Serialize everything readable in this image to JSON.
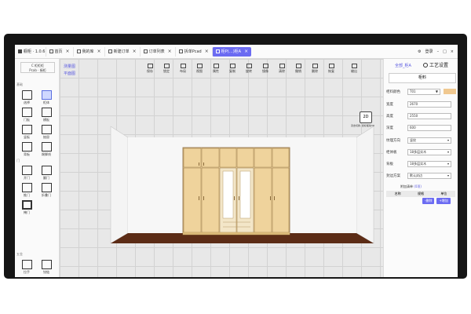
{
  "window": {
    "title": "橱柜 · 1.0.6",
    "tabs": [
      {
        "label": "首页",
        "active": false
      },
      {
        "label": "我的库",
        "active": false
      },
      {
        "label": "新建订单",
        "active": false
      },
      {
        "label": "订单列表",
        "active": false
      },
      {
        "label": "拆单Pcad",
        "active": false
      },
      {
        "label": "柜P(…)柜A",
        "active": true
      }
    ],
    "right_items": [
      "登录"
    ]
  },
  "sidebar": {
    "logo_line1": "C 柜柜柜",
    "logo_line2": "Pcab · 橱柜",
    "section_basic": "基础",
    "tools": [
      {
        "label": "选择",
        "selected": false
      },
      {
        "label": "柜体",
        "selected": true
      },
      {
        "label": "门板",
        "selected": false
      },
      {
        "label": "横板",
        "selected": false
      },
      {
        "label": "竖板",
        "selected": false
      },
      {
        "label": "抽屉",
        "selected": false
      },
      {
        "label": "背板",
        "selected": false
      },
      {
        "label": "踢脚线",
        "selected": false
      }
    ],
    "section_door": "门",
    "door_tools": [
      {
        "label": "开门",
        "selected": false
      },
      {
        "label": "翻门",
        "selected": false
      },
      {
        "label": "推门",
        "selected": false
      },
      {
        "label": "折叠门",
        "selected": false
      },
      {
        "label": "掩门",
        "selected": false
      }
    ],
    "section_hw": "五金",
    "hw_tools": [
      {
        "label": "拉手"
      },
      {
        "label": "铰链"
      }
    ]
  },
  "canvas": {
    "links": [
      "测量图",
      "平面图"
    ],
    "toolbar": [
      "保存",
      "锁定",
      "布局",
      "视图",
      "属性",
      "复制",
      "旋转",
      "镜像",
      "清除",
      "撤销",
      "删除",
      "恢复",
      "输出"
    ],
    "view_toggle": "2D",
    "view_note": "双击切换, 鼠标拖动3D"
  },
  "panel": {
    "header_link": "全部_柜A",
    "title": "工艺设置",
    "button": "柜料",
    "fields": [
      {
        "label": "柜料颜色",
        "value": "T01",
        "type": "select",
        "swatch": "#f0c890"
      },
      {
        "label": "宽度",
        "value": "2670",
        "type": "input"
      },
      {
        "label": "高度",
        "value": "2550",
        "type": "input"
      },
      {
        "label": "深度",
        "value": "600",
        "type": "input"
      },
      {
        "label": "纹理方向",
        "value": "竖纹",
        "type": "select"
      },
      {
        "label": "柜体板",
        "value": "18多层实木",
        "type": "select"
      },
      {
        "label": "背板",
        "value": "18多层实木",
        "type": "select"
      },
      {
        "label": "封边方案",
        "value": "默认封边",
        "type": "select"
      }
    ],
    "library_label": "附加清单",
    "library_link": "(0项)",
    "table_headers": [
      "名称",
      "规格",
      "单位"
    ],
    "buttons": [
      "-删除",
      "+增加"
    ]
  },
  "colors": {
    "accent": "#6b6bf2",
    "wood": "#f0c890",
    "floor": "#5c2c16"
  }
}
